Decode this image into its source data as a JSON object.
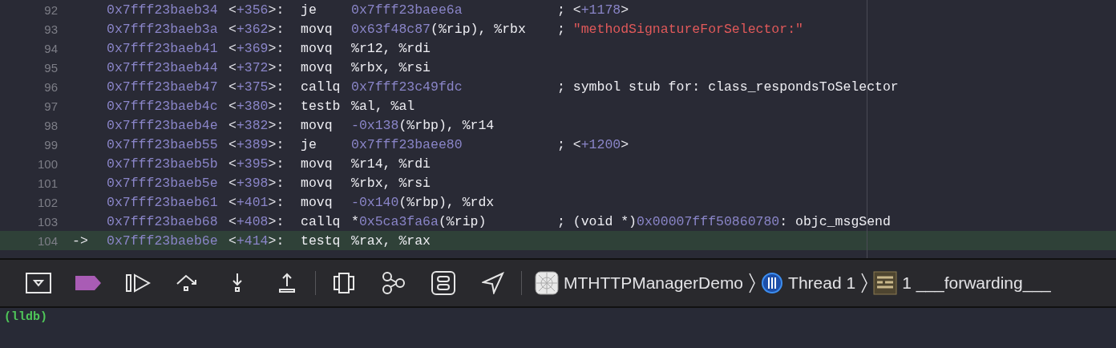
{
  "disassembly": {
    "rows": [
      {
        "line": "92",
        "current": false,
        "address": "0x7fff23baeb34",
        "offset": [
          {
            "kind": "plain",
            "text": "<"
          },
          {
            "kind": "num",
            "text": "+356"
          },
          {
            "kind": "plain",
            "text": ">:"
          }
        ],
        "mnemonic": "je",
        "operands": [
          {
            "kind": "num",
            "text": "0x7fff23baee6a"
          }
        ],
        "comment": [
          {
            "kind": "plain",
            "text": "; <"
          },
          {
            "kind": "num",
            "text": "+1178"
          },
          {
            "kind": "plain",
            "text": ">"
          }
        ]
      },
      {
        "line": "93",
        "current": false,
        "address": "0x7fff23baeb3a",
        "offset": [
          {
            "kind": "plain",
            "text": "<"
          },
          {
            "kind": "num",
            "text": "+362"
          },
          {
            "kind": "plain",
            "text": ">:"
          }
        ],
        "mnemonic": "movq",
        "operands": [
          {
            "kind": "num",
            "text": "0x63f48c87"
          },
          {
            "kind": "plain",
            "text": "(%rip), %rbx"
          }
        ],
        "comment": [
          {
            "kind": "plain",
            "text": "; "
          },
          {
            "kind": "str",
            "text": "\"methodSignatureForSelector:\""
          }
        ]
      },
      {
        "line": "94",
        "current": false,
        "address": "0x7fff23baeb41",
        "offset": [
          {
            "kind": "plain",
            "text": "<"
          },
          {
            "kind": "num",
            "text": "+369"
          },
          {
            "kind": "plain",
            "text": ">:"
          }
        ],
        "mnemonic": "movq",
        "operands": [
          {
            "kind": "plain",
            "text": "%r12, %rdi"
          }
        ]
      },
      {
        "line": "95",
        "current": false,
        "address": "0x7fff23baeb44",
        "offset": [
          {
            "kind": "plain",
            "text": "<"
          },
          {
            "kind": "num",
            "text": "+372"
          },
          {
            "kind": "plain",
            "text": ">:"
          }
        ],
        "mnemonic": "movq",
        "operands": [
          {
            "kind": "plain",
            "text": "%rbx, %rsi"
          }
        ]
      },
      {
        "line": "96",
        "current": false,
        "address": "0x7fff23baeb47",
        "offset": [
          {
            "kind": "plain",
            "text": "<"
          },
          {
            "kind": "num",
            "text": "+375"
          },
          {
            "kind": "plain",
            "text": ">:"
          }
        ],
        "mnemonic": "callq",
        "operands": [
          {
            "kind": "num",
            "text": "0x7fff23c49fdc"
          }
        ],
        "comment": [
          {
            "kind": "plain",
            "text": "; symbol stub for: class_respondsToSelector"
          }
        ]
      },
      {
        "line": "97",
        "current": false,
        "address": "0x7fff23baeb4c",
        "offset": [
          {
            "kind": "plain",
            "text": "<"
          },
          {
            "kind": "num",
            "text": "+380"
          },
          {
            "kind": "plain",
            "text": ">:"
          }
        ],
        "mnemonic": "testb",
        "operands": [
          {
            "kind": "plain",
            "text": "%al, %al"
          }
        ]
      },
      {
        "line": "98",
        "current": false,
        "address": "0x7fff23baeb4e",
        "offset": [
          {
            "kind": "plain",
            "text": "<"
          },
          {
            "kind": "num",
            "text": "+382"
          },
          {
            "kind": "plain",
            "text": ">:"
          }
        ],
        "mnemonic": "movq",
        "operands": [
          {
            "kind": "num",
            "text": "-0x138"
          },
          {
            "kind": "plain",
            "text": "(%rbp), %r14"
          }
        ]
      },
      {
        "line": "99",
        "current": false,
        "address": "0x7fff23baeb55",
        "offset": [
          {
            "kind": "plain",
            "text": "<"
          },
          {
            "kind": "num",
            "text": "+389"
          },
          {
            "kind": "plain",
            "text": ">:"
          }
        ],
        "mnemonic": "je",
        "operands": [
          {
            "kind": "num",
            "text": "0x7fff23baee80"
          }
        ],
        "comment": [
          {
            "kind": "plain",
            "text": "; <"
          },
          {
            "kind": "num",
            "text": "+1200"
          },
          {
            "kind": "plain",
            "text": ">"
          }
        ]
      },
      {
        "line": "100",
        "current": false,
        "address": "0x7fff23baeb5b",
        "offset": [
          {
            "kind": "plain",
            "text": "<"
          },
          {
            "kind": "num",
            "text": "+395"
          },
          {
            "kind": "plain",
            "text": ">:"
          }
        ],
        "mnemonic": "movq",
        "operands": [
          {
            "kind": "plain",
            "text": "%r14, %rdi"
          }
        ]
      },
      {
        "line": "101",
        "current": false,
        "address": "0x7fff23baeb5e",
        "offset": [
          {
            "kind": "plain",
            "text": "<"
          },
          {
            "kind": "num",
            "text": "+398"
          },
          {
            "kind": "plain",
            "text": ">:"
          }
        ],
        "mnemonic": "movq",
        "operands": [
          {
            "kind": "plain",
            "text": "%rbx, %rsi"
          }
        ]
      },
      {
        "line": "102",
        "current": false,
        "address": "0x7fff23baeb61",
        "offset": [
          {
            "kind": "plain",
            "text": "<"
          },
          {
            "kind": "num",
            "text": "+401"
          },
          {
            "kind": "plain",
            "text": ">:"
          }
        ],
        "mnemonic": "movq",
        "operands": [
          {
            "kind": "num",
            "text": "-0x140"
          },
          {
            "kind": "plain",
            "text": "(%rbp), %rdx"
          }
        ]
      },
      {
        "line": "103",
        "current": false,
        "address": "0x7fff23baeb68",
        "offset": [
          {
            "kind": "plain",
            "text": "<"
          },
          {
            "kind": "num",
            "text": "+408"
          },
          {
            "kind": "plain",
            "text": ">:"
          }
        ],
        "mnemonic": "callq",
        "operands": [
          {
            "kind": "plain",
            "text": "*"
          },
          {
            "kind": "num",
            "text": "0x5ca3fa6a"
          },
          {
            "kind": "plain",
            "text": "(%rip)"
          }
        ],
        "comment": [
          {
            "kind": "plain",
            "text": "; (void *)"
          },
          {
            "kind": "num",
            "text": "0x00007fff50860780"
          },
          {
            "kind": "plain",
            "text": ": objc_msgSend"
          }
        ]
      },
      {
        "line": "104",
        "current": true,
        "arrow": "->",
        "address": "0x7fff23baeb6e",
        "offset": [
          {
            "kind": "plain",
            "text": "<"
          },
          {
            "kind": "num",
            "text": "+414"
          },
          {
            "kind": "plain",
            "text": ">:"
          }
        ],
        "mnemonic": "testq",
        "operands": [
          {
            "kind": "plain",
            "text": "%rax, %rax"
          }
        ]
      }
    ]
  },
  "debug_bar": {
    "breadcrumbs": [
      {
        "kind": "app",
        "text": "MTHTTPManagerDemo"
      },
      {
        "kind": "thread",
        "text": "Thread 1"
      },
      {
        "kind": "frame",
        "text": "1 ___forwarding___"
      }
    ]
  },
  "console": {
    "prompt": "(lldb)"
  }
}
